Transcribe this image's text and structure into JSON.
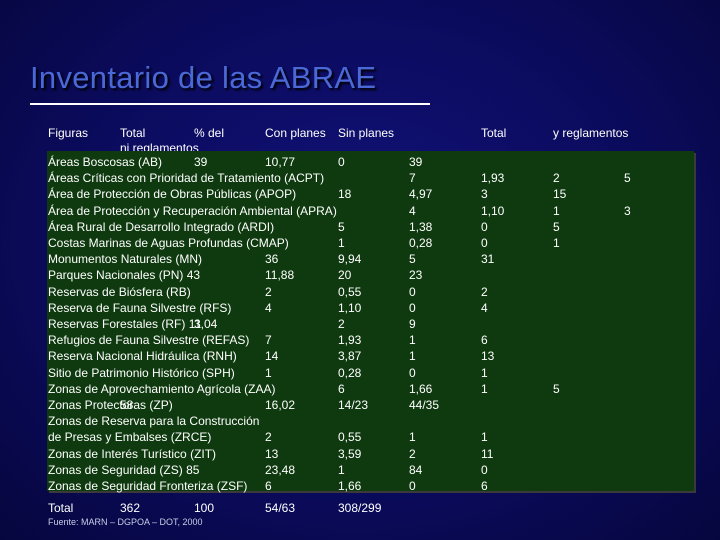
{
  "slide": {
    "title": "Inventario de las ABRAE",
    "source": "Fuente: MARN – DGPOA – DOT, 2000"
  },
  "header": {
    "figuras": "Figuras",
    "total": "Total",
    "pct": "% del",
    "con_planes": "Con planes",
    "sin_planes": "Sin planes",
    "total2": "Total",
    "reglamentos": "y reglamentos",
    "sub": "ni reglamentos"
  },
  "rows": [
    {
      "name": "Áreas Boscosas (AB)",
      "total": "39",
      "pct": "10,77",
      "con": "0",
      "sin": "39",
      "t2": "",
      "c6": "",
      "c7": ""
    },
    {
      "name": "Áreas Críticas con Prioridad de Tratamiento (ACPT)",
      "total": "",
      "pct": "",
      "con": "",
      "sin": "7",
      "t2": "1,93",
      "c6": "2",
      "c7": "5"
    },
    {
      "name": "Área de Protección de Obras Públicas (APOP)",
      "total": "",
      "pct": "",
      "con": "18",
      "sin": "4,97",
      "t2": "3",
      "c6": "15",
      "c7": ""
    },
    {
      "name": "Área de Protección y Recuperación Ambiental (APRA)",
      "total": "",
      "pct": "",
      "con": "",
      "sin": "4",
      "t2": "1,10",
      "c6": "1",
      "c7": "3"
    },
    {
      "name": "Área Rural de Desarrollo Integrado (ARDI)",
      "total": "",
      "pct": "",
      "con": "5",
      "sin": "1,38",
      "t2": "0",
      "c6": "5",
      "c7": ""
    },
    {
      "name": "Costas Marinas de Aguas Profundas (CMAP)",
      "total": "",
      "pct": "",
      "con": "1",
      "sin": "0,28",
      "t2": "0",
      "c6": "1",
      "c7": ""
    },
    {
      "name": "Monumentos Naturales (MN)",
      "total": "36",
      "pct": "9,94",
      "con": "5",
      "sin": "31",
      "t2": "",
      "c6": "",
      "c7": ""
    },
    {
      "name": "Parques Nacionales (PN) 43",
      "total": "",
      "pct": "11,88",
      "con": "20",
      "sin": "23",
      "t2": "",
      "c6": "",
      "c7": ""
    },
    {
      "name": "Reservas de Biósfera (RB)",
      "total": "2",
      "pct": "0,55",
      "con": "0",
      "sin": "2",
      "t2": "",
      "c6": "",
      "c7": ""
    },
    {
      "name": "Reserva de Fauna Silvestre (RFS)",
      "total": "4",
      "pct": "1,10",
      "con": "0",
      "sin": "4",
      "t2": "",
      "c6": "",
      "c7": ""
    },
    {
      "name": "Reservas Forestales (RF) 11",
      "total": "",
      "pct": "3,04",
      "con": "2",
      "sin": "9",
      "t2": "",
      "c6": "",
      "c7": ""
    },
    {
      "name": "Refugios de Fauna Silvestre (REFAS)",
      "total": "7",
      "pct": "",
      "con": "1,93",
      "sin": "1",
      "t2": "6",
      "c6": "",
      "c7": ""
    },
    {
      "name": "Reserva Nacional Hidráulica (RNH)",
      "total": "14",
      "pct": "",
      "con": "3,87",
      "sin": "1",
      "t2": "13",
      "c6": "",
      "c7": ""
    },
    {
      "name": "Sitio de Patrimonio Histórico (SPH)",
      "total": "1",
      "pct": "",
      "con": "0,28",
      "sin": "0",
      "t2": "1",
      "c6": "",
      "c7": ""
    },
    {
      "name": "Zonas de Aprovechamiento Agrícola (ZAA)",
      "total": "",
      "pct": "",
      "con": "6",
      "sin": "1,66",
      "t2": "1",
      "c6": "5",
      "c7": ""
    },
    {
      "name": "Zonas Protectoras (ZP)",
      "total": "58",
      "pct": "16,02",
      "con": "14/23",
      "sin": "44/35",
      "t2": "",
      "c6": "",
      "c7": ""
    },
    {
      "name": "Zonas de Reserva para la Construcción",
      "total": "",
      "pct": "",
      "con": "",
      "sin": "",
      "t2": "",
      "c6": "",
      "c7": ""
    },
    {
      "name": "de Presas y Embalses (ZRCE)",
      "total": "2",
      "pct": "",
      "con": "0,55",
      "sin": "1",
      "t2": "1",
      "c6": "",
      "c7": ""
    },
    {
      "name": "Zonas de Interés Turístico (ZIT)",
      "total": "13",
      "pct": "",
      "con": "3,59",
      "sin": "2",
      "t2": "11",
      "c6": "",
      "c7": ""
    },
    {
      "name": "Zonas de Seguridad (ZS) 85",
      "total": "",
      "pct": "23,48",
      "con": "1",
      "sin": "84",
      "t2": "0",
      "c6": "",
      "c7": ""
    },
    {
      "name": "Zonas de Seguridad Fronteriza (ZSF)",
      "total": "6",
      "pct": "",
      "con": "1,66",
      "sin": "0",
      "t2": "6",
      "c6": "",
      "c7": ""
    }
  ],
  "footer": {
    "label": "Total",
    "total": "362",
    "pct": "100",
    "con": "54/63",
    "sin": "308/299"
  }
}
